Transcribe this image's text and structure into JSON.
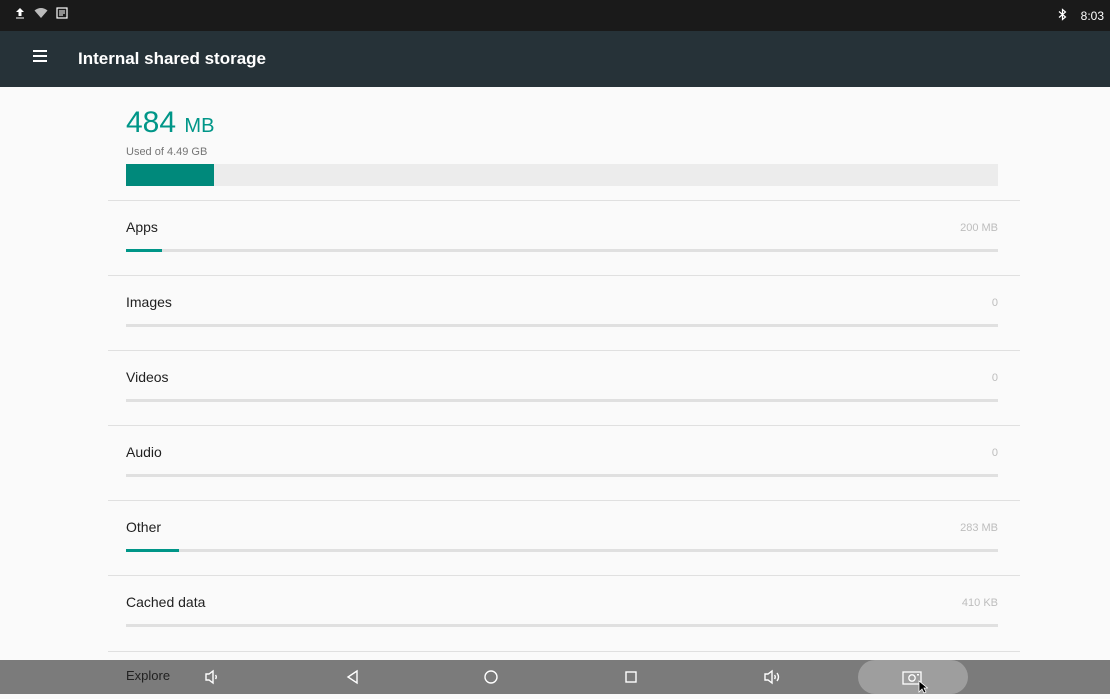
{
  "status_bar": {
    "time": "8:03",
    "icons": [
      "upload-icon",
      "wifi-icon",
      "storage-icon",
      "bluetooth-icon"
    ]
  },
  "app_bar": {
    "title": "Internal shared storage"
  },
  "summary": {
    "used_value": "484",
    "used_unit": "MB",
    "used_of": "Used of 4.49 GB",
    "used_fraction": 0.101
  },
  "categories": [
    {
      "label": "Apps",
      "value": "200 MB",
      "fraction": 0.041
    },
    {
      "label": "Images",
      "value": "0",
      "fraction": 0
    },
    {
      "label": "Videos",
      "value": "0",
      "fraction": 0
    },
    {
      "label": "Audio",
      "value": "0",
      "fraction": 0
    },
    {
      "label": "Other",
      "value": "283 MB",
      "fraction": 0.061
    },
    {
      "label": "Cached data",
      "value": "410 KB",
      "fraction": 0
    }
  ],
  "explore": {
    "label": "Explore"
  },
  "nav": [
    "volume-down-icon",
    "back-icon",
    "home-icon",
    "recents-icon",
    "volume-up-icon",
    "screenshot-icon"
  ],
  "colors": {
    "accent": "#009688",
    "app_bar": "#263238",
    "status_bar": "#1a1a1a",
    "nav_bar": "#7b7b7b"
  }
}
